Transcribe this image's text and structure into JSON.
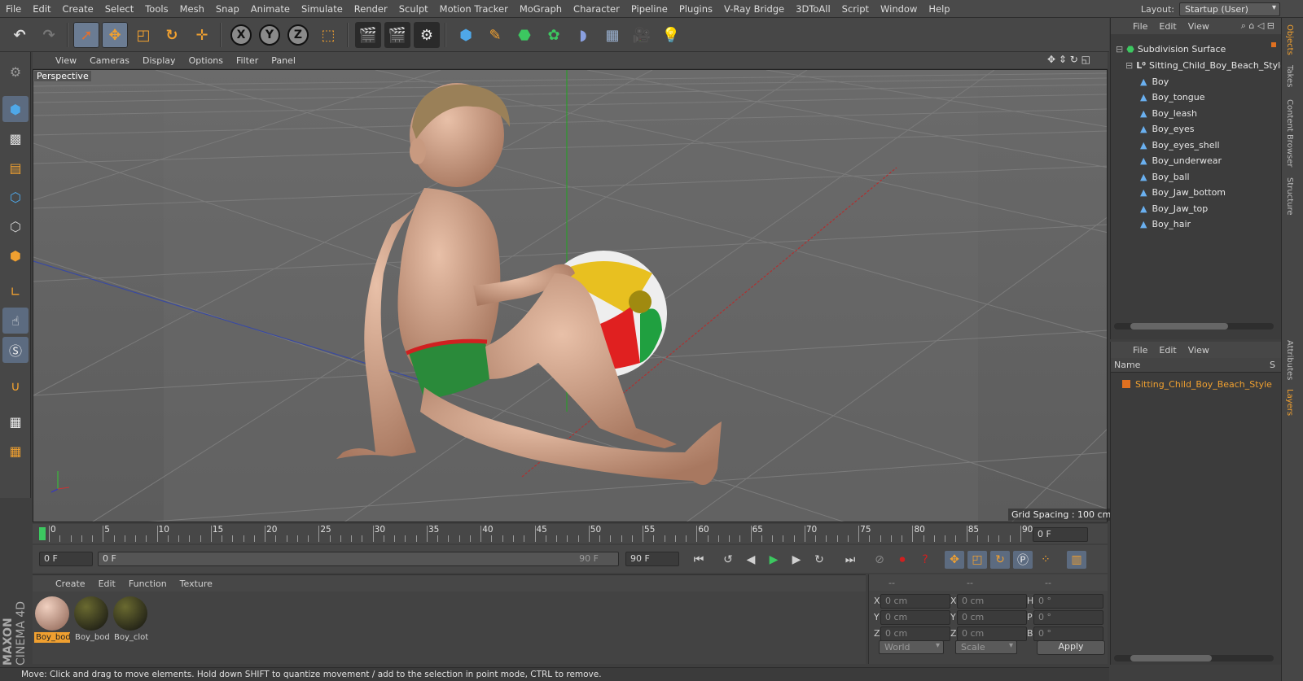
{
  "menu": [
    "File",
    "Edit",
    "Create",
    "Select",
    "Tools",
    "Mesh",
    "Snap",
    "Animate",
    "Simulate",
    "Render",
    "Sculpt",
    "Motion Tracker",
    "MoGraph",
    "Character",
    "Pipeline",
    "Plugins",
    "V-Ray Bridge",
    "3DToAll",
    "Script",
    "Window",
    "Help"
  ],
  "layout": {
    "label": "Layout:",
    "value": "Startup (User)"
  },
  "toolbar": {
    "axis_x": "X",
    "axis_y": "Y",
    "axis_z": "Z"
  },
  "viewport": {
    "menu": [
      "View",
      "Cameras",
      "Display",
      "Options",
      "Filter",
      "Panel"
    ],
    "label": "Perspective",
    "grid_spacing": "Grid Spacing : 100 cm"
  },
  "timeline": {
    "ticks": [
      "0",
      "5",
      "10",
      "15",
      "20",
      "25",
      "30",
      "35",
      "40",
      "45",
      "50",
      "55",
      "60",
      "65",
      "70",
      "75",
      "80",
      "85",
      "90"
    ],
    "frame_right": "0 F"
  },
  "controls": {
    "start": "0 F",
    "slider_left": "0 F",
    "slider_right": "90 F",
    "end": "90 F"
  },
  "materials": {
    "menu": [
      "Create",
      "Edit",
      "Function",
      "Texture"
    ],
    "items": [
      "Boy_bod",
      "Boy_bod",
      "Boy_clot"
    ]
  },
  "coords": {
    "header_left": "--",
    "header_mid": "--",
    "header_right": "--",
    "rows": [
      {
        "a": "X",
        "av": "0 cm",
        "b": "X",
        "bv": "0 cm",
        "c": "H",
        "cv": "0 °"
      },
      {
        "a": "Y",
        "av": "0 cm",
        "b": "Y",
        "bv": "0 cm",
        "c": "P",
        "cv": "0 °"
      },
      {
        "a": "Z",
        "av": "0 cm",
        "b": "Z",
        "bv": "0 cm",
        "c": "B",
        "cv": "0 °"
      }
    ],
    "mode1": "World",
    "mode2": "Scale",
    "apply": "Apply"
  },
  "status": "Move: Click and drag to move elements. Hold down SHIFT to quantize movement / add to the selection in point mode, CTRL to remove.",
  "objects": {
    "menu": [
      "File",
      "Edit",
      "View"
    ],
    "root": "Subdivision Surface",
    "child": "Sitting_Child_Boy_Beach_Style",
    "items": [
      "Boy",
      "Boy_tongue",
      "Boy_leash",
      "Boy_eyes",
      "Boy_eyes_shell",
      "Boy_underwear",
      "Boy_ball",
      "Boy_Jaw_bottom",
      "Boy_Jaw_top",
      "Boy_hair"
    ]
  },
  "layers": {
    "menu": [
      "File",
      "Edit",
      "View"
    ],
    "col_name": "Name",
    "col_s": "S",
    "item": "Sitting_Child_Boy_Beach_Style"
  },
  "sidetabs": [
    "Objects",
    "Takes",
    "Content Browser",
    "Structure",
    "Attributes",
    "Layers"
  ],
  "brand": {
    "line1": "MAXON",
    "line2": "CINEMA 4D"
  },
  "colors": {
    "accent": "#f0a030",
    "highlight": "#6b7c93",
    "layer_orange": "#e07020"
  }
}
